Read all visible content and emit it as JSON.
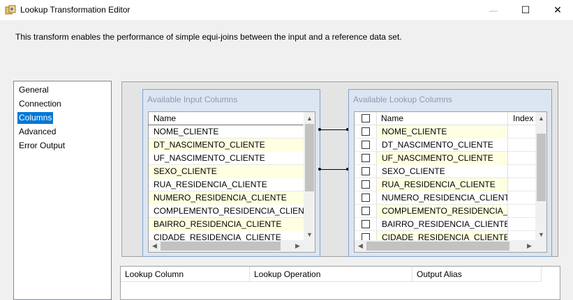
{
  "window": {
    "title": "Lookup Transformation Editor",
    "minimize_glyph": "—",
    "maximize_glyph": "☐",
    "close_glyph": "✕"
  },
  "description": "This transform enables the performance of simple equi-joins between the input and a reference data set.",
  "nav": {
    "items": [
      {
        "label": "General",
        "selected": false
      },
      {
        "label": "Connection",
        "selected": false
      },
      {
        "label": "Columns",
        "selected": true
      },
      {
        "label": "Advanced",
        "selected": false
      },
      {
        "label": "Error Output",
        "selected": false
      }
    ]
  },
  "input_columns": {
    "title": "Available Input Columns",
    "header": "Name",
    "rows": [
      {
        "name": "NOME_CLIENTE",
        "highlight": false
      },
      {
        "name": "DT_NASCIMENTO_CLIENTE",
        "highlight": true
      },
      {
        "name": "UF_NASCIMENTO_CLIENTE",
        "highlight": false
      },
      {
        "name": "SEXO_CLIENTE",
        "highlight": true
      },
      {
        "name": "RUA_RESIDENCIA_CLIENTE",
        "highlight": false
      },
      {
        "name": "NUMERO_RESIDENCIA_CLIENTE",
        "highlight": true
      },
      {
        "name": "COMPLEMENTO_RESIDENCIA_CLIENTE",
        "highlight": false
      },
      {
        "name": "BAIRRO_RESIDENCIA_CLIENTE",
        "highlight": true
      },
      {
        "name": "CIDADE_RESIDENCIA_CLIENTE",
        "highlight": false
      }
    ]
  },
  "lookup_columns": {
    "title": "Available Lookup Columns",
    "header_name": "Name",
    "header_index": "Index",
    "rows": [
      {
        "name": "NOME_CLIENTE",
        "checked": false,
        "highlight": true
      },
      {
        "name": "DT_NASCIMENTO_CLIENTE",
        "checked": false,
        "highlight": false
      },
      {
        "name": "UF_NASCIMENTO_CLIENTE",
        "checked": false,
        "highlight": true
      },
      {
        "name": "SEXO_CLIENTE",
        "checked": false,
        "highlight": false
      },
      {
        "name": "RUA_RESIDENCIA_CLIENTE",
        "checked": false,
        "highlight": true
      },
      {
        "name": "NUMERO_RESIDENCIA_CLIENTE",
        "checked": false,
        "highlight": false
      },
      {
        "name": "COMPLEMENTO_RESIDENCIA_...",
        "checked": false,
        "highlight": true
      },
      {
        "name": "BAIRRO_RESIDENCIA_CLIENTE",
        "checked": false,
        "highlight": false
      },
      {
        "name": "CIDADE_RESIDENCIA_CLIENTE",
        "checked": false,
        "highlight": true
      }
    ]
  },
  "lookup_grid": {
    "headers": [
      "Lookup Column",
      "Lookup Operation",
      "Output Alias"
    ]
  },
  "colors": {
    "accent": "#0078d7",
    "row_highlight": "#ffffe1",
    "box_background": "#dce6f2"
  }
}
